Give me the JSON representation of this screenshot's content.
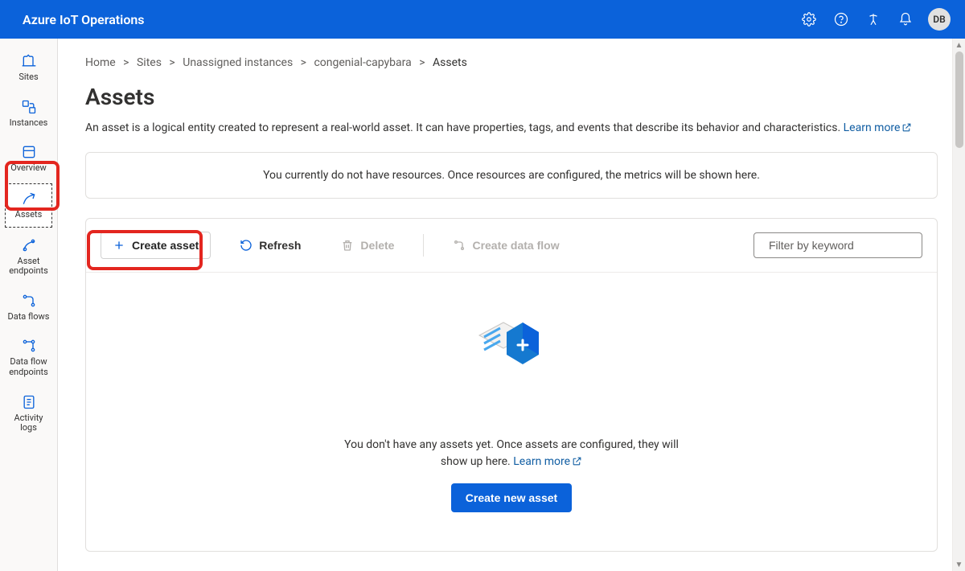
{
  "header": {
    "product": "Azure IoT Operations",
    "avatar": "DB"
  },
  "sidebar": {
    "items": [
      {
        "label": "Sites"
      },
      {
        "label": "Instances"
      },
      {
        "label": "Overview"
      },
      {
        "label": "Assets"
      },
      {
        "label": "Asset endpoints"
      },
      {
        "label": "Data flows"
      },
      {
        "label": "Data flow endpoints"
      },
      {
        "label": "Activity logs"
      }
    ]
  },
  "breadcrumb": {
    "items": [
      "Home",
      "Sites",
      "Unassigned instances",
      "congenial-capybara",
      "Assets"
    ]
  },
  "page": {
    "title": "Assets",
    "description": "An asset is a logical entity created to represent a real-world asset. It can have properties, tags, and events that describe its behavior and characteristics.",
    "learn_more": "Learn more",
    "metrics_empty": "You currently do not have resources. Once resources are configured, the metrics will be shown here."
  },
  "toolbar": {
    "create": "Create asset",
    "refresh": "Refresh",
    "delete": "Delete",
    "dataflow": "Create data flow",
    "filter_placeholder": "Filter by keyword"
  },
  "empty": {
    "line": "You don't have any assets yet. Once assets are configured, they will show up here.",
    "learn_more": "Learn more",
    "cta": "Create new asset"
  }
}
